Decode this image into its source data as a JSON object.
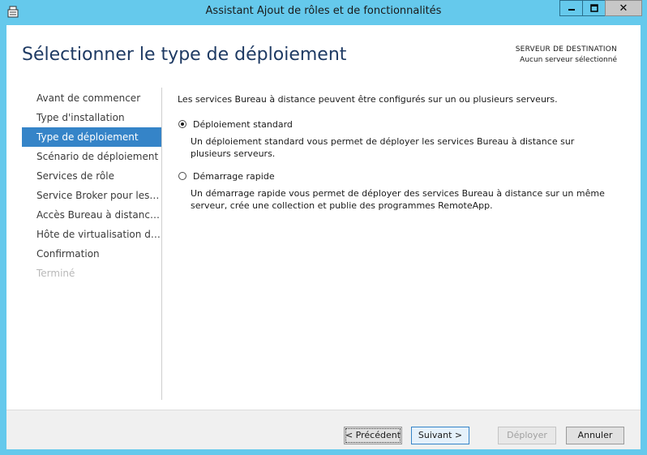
{
  "window": {
    "title": "Assistant Ajout de rôles et de fonctionnalités",
    "controls": {
      "minimize_icon": "minimize-icon",
      "maximize_icon": "maximize-icon",
      "close_icon": "close-icon"
    }
  },
  "header": {
    "title": "Sélectionner le type de déploiement",
    "destination_label": "SERVEUR DE DESTINATION",
    "destination_value": "Aucun serveur sélectionné"
  },
  "sidebar": {
    "items": [
      {
        "label": "Avant de commencer",
        "state": "normal"
      },
      {
        "label": "Type d'installation",
        "state": "normal"
      },
      {
        "label": "Type de déploiement",
        "state": "active"
      },
      {
        "label": "Scénario de déploiement",
        "state": "normal"
      },
      {
        "label": "Services de rôle",
        "state": "normal"
      },
      {
        "label": "Service Broker pour les c...",
        "state": "normal"
      },
      {
        "label": "Accès Bureau à distance...",
        "state": "normal"
      },
      {
        "label": "Hôte de virtualisation des...",
        "state": "normal"
      },
      {
        "label": "Confirmation",
        "state": "normal"
      },
      {
        "label": "Terminé",
        "state": "disabled"
      }
    ]
  },
  "main": {
    "intro": "Les services Bureau à distance peuvent être configurés sur un ou plusieurs serveurs.",
    "options": [
      {
        "label": "Déploiement standard",
        "selected": true,
        "description": "Un déploiement standard vous permet de déployer les services Bureau à distance sur plusieurs serveurs."
      },
      {
        "label": "Démarrage rapide",
        "selected": false,
        "description": "Un démarrage rapide vous permet de déployer des services Bureau à distance sur un même serveur, crée une collection et publie des programmes RemoteApp."
      }
    ]
  },
  "footer": {
    "previous_label": "< Précédent",
    "next_label": "Suivant >",
    "deploy_label": "Déployer",
    "cancel_label": "Annuler"
  },
  "colors": {
    "accent": "#3584c8",
    "titlebar": "#65c9ec",
    "heading": "#1e3a63"
  }
}
